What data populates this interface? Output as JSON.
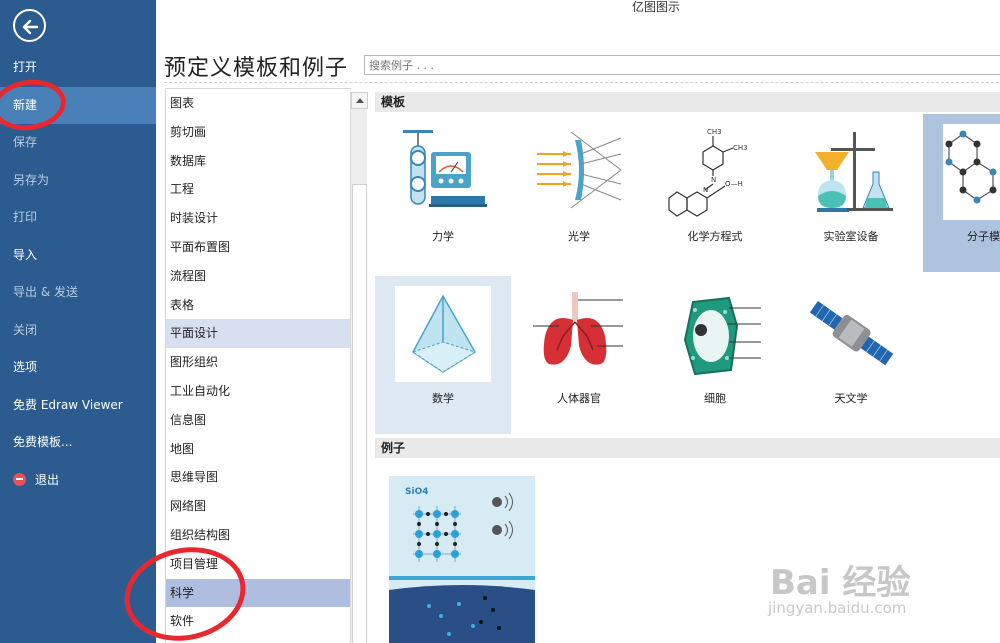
{
  "app": {
    "title": "亿图图示"
  },
  "sidebar": {
    "menu": [
      {
        "label": "打开"
      },
      {
        "label": "新建"
      },
      {
        "label": "保存"
      },
      {
        "label": "另存为"
      },
      {
        "label": "打印"
      },
      {
        "label": "导入"
      },
      {
        "label": "导出 & 发送"
      },
      {
        "label": "关闭"
      },
      {
        "label": "选项"
      },
      {
        "label": "免费 Edraw Viewer"
      },
      {
        "label": "免费模板..."
      },
      {
        "label": "退出"
      }
    ],
    "colors": {
      "background": "#2c5c8f",
      "active": "#4a80b8"
    }
  },
  "main": {
    "title": "预定义模板和例子",
    "search": {
      "placeholder": "搜索例子 . . ."
    }
  },
  "categories": [
    {
      "label": "图表"
    },
    {
      "label": "剪切画"
    },
    {
      "label": "数据库"
    },
    {
      "label": "工程"
    },
    {
      "label": "时装设计"
    },
    {
      "label": "平面布置图"
    },
    {
      "label": "流程图"
    },
    {
      "label": "表格"
    },
    {
      "label": "平面设计"
    },
    {
      "label": "图形组织"
    },
    {
      "label": "工业自动化"
    },
    {
      "label": "信息图"
    },
    {
      "label": "地图"
    },
    {
      "label": "思维导图"
    },
    {
      "label": "网络图"
    },
    {
      "label": "组织结构图"
    },
    {
      "label": "项目管理"
    },
    {
      "label": "科学"
    },
    {
      "label": "软件"
    }
  ],
  "gallery": {
    "templates_header": "模板",
    "examples_header": "例子",
    "templates": [
      {
        "label": "力学",
        "icon": "mechanics-icon"
      },
      {
        "label": "光学",
        "icon": "optics-icon"
      },
      {
        "label": "化学方程式",
        "icon": "chemical-formula-icon"
      },
      {
        "label": "实验室设备",
        "icon": "lab-equipment-icon"
      },
      {
        "label": "分子模",
        "icon": "molecule-model-icon"
      },
      {
        "label": "数学",
        "icon": "pyramid-icon"
      },
      {
        "label": "人体器官",
        "icon": "lungs-icon"
      },
      {
        "label": "细胞",
        "icon": "cell-icon"
      },
      {
        "label": "天文学",
        "icon": "satellite-icon"
      }
    ],
    "example": {
      "formula": "SiO4"
    },
    "formula_labels": {
      "ch3_top": "CH3",
      "ch3_right": "CH3",
      "n": "N",
      "oh": "O—H"
    }
  },
  "watermark": {
    "main": "Bai 经验",
    "sub": "jingyan.baidu.com"
  },
  "annotation_color": "#e8282e"
}
